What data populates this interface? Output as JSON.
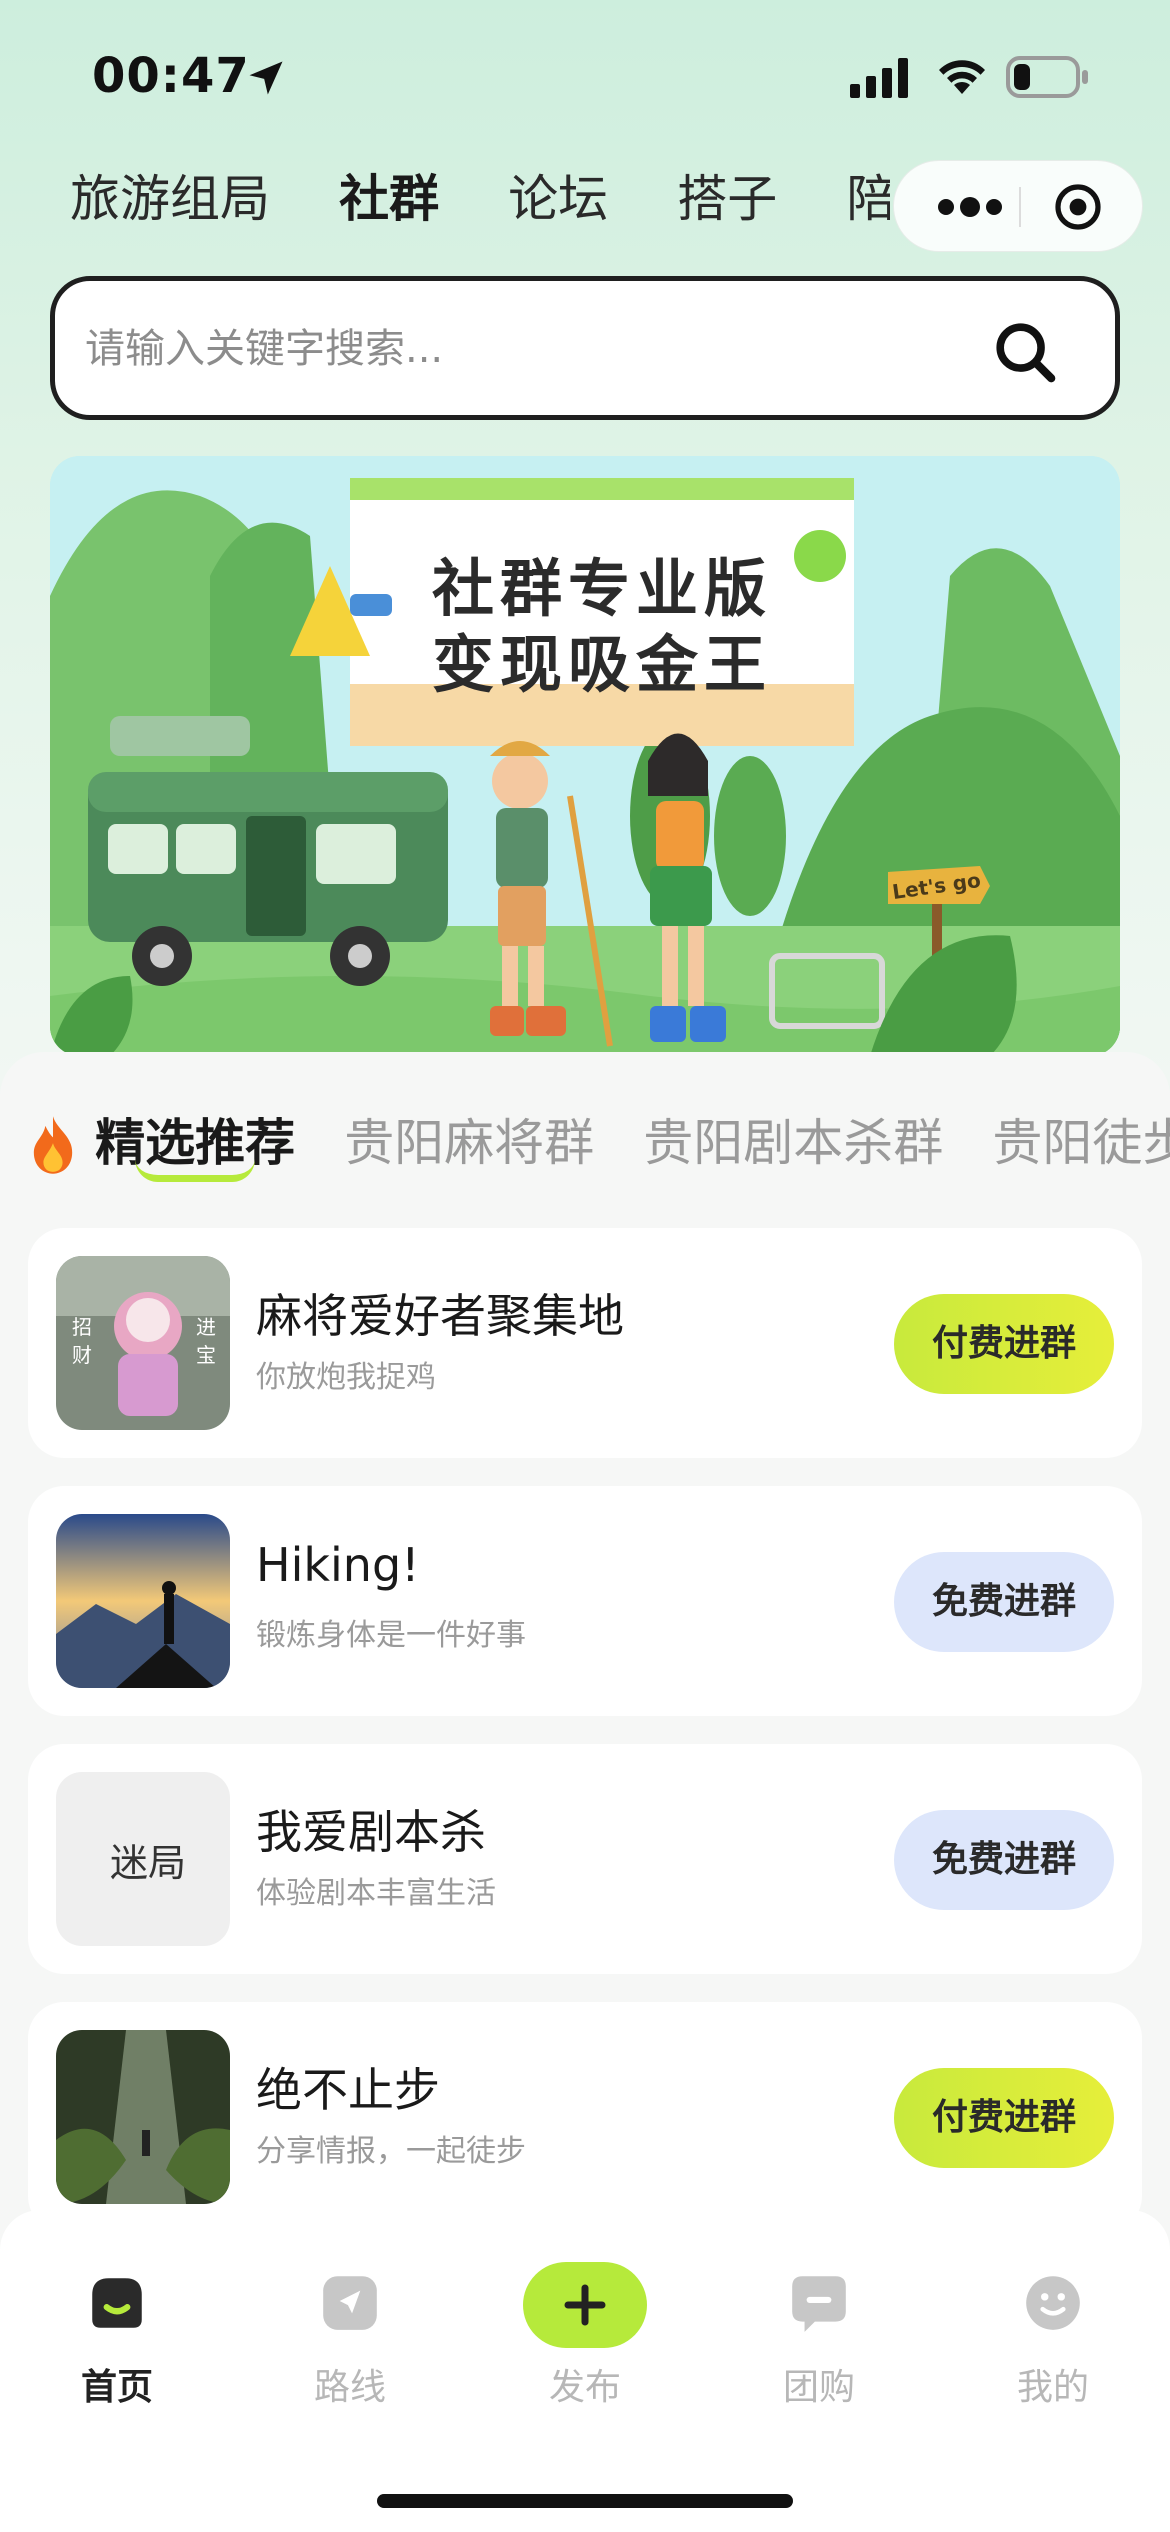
{
  "status_bar": {
    "time": "00:47"
  },
  "top_tabs": [
    {
      "label": "旅游组局",
      "active": false
    },
    {
      "label": "社群",
      "active": true
    },
    {
      "label": "论坛",
      "active": false
    },
    {
      "label": "搭子",
      "active": false
    },
    {
      "label": "陪玩",
      "active": false
    }
  ],
  "search": {
    "placeholder": "请输入关键字搜索..."
  },
  "banner": {
    "title_line1": "社群专业版",
    "title_line2": "变现吸金王",
    "sign_text": "Let's go"
  },
  "category_tabs": [
    {
      "label": "精选推荐",
      "active": true
    },
    {
      "label": "贵阳麻将群",
      "active": false
    },
    {
      "label": "贵阳剧本杀群",
      "active": false
    },
    {
      "label": "贵阳徒步群",
      "active": false
    }
  ],
  "groups": [
    {
      "name": "麻将爱好者聚集地",
      "desc": "你放炮我捉鸡",
      "button": "付费进群",
      "type": "paid",
      "thumb": "mahjong-art",
      "thumb_text": [
        "招",
        "财",
        "进",
        "宝"
      ]
    },
    {
      "name": "Hiking!",
      "desc": "锻炼身体是一件好事",
      "button": "免费进群",
      "type": "free",
      "thumb": "hiker-mountain"
    },
    {
      "name": "我爱剧本杀",
      "desc": "体验剧本丰富生活",
      "button": "免费进群",
      "type": "free",
      "thumb": "mystery-logo",
      "thumb_text": [
        "迷局"
      ]
    },
    {
      "name": "绝不止步",
      "desc": "分享情报，一起徒步",
      "button": "付费进群",
      "type": "paid",
      "thumb": "forest-path"
    }
  ],
  "bottom_nav": [
    {
      "label": "首页",
      "icon": "home-icon",
      "active": true
    },
    {
      "label": "路线",
      "icon": "route-icon",
      "active": false
    },
    {
      "label": "发布",
      "icon": "plus-icon",
      "active": false
    },
    {
      "label": "团购",
      "icon": "group-buy-icon",
      "active": false
    },
    {
      "label": "我的",
      "icon": "profile-icon",
      "active": false
    }
  ],
  "colors": {
    "accent_green": "#b6ea3b",
    "paid_button": "#d4ec3c",
    "free_button": "#dde6fb"
  }
}
